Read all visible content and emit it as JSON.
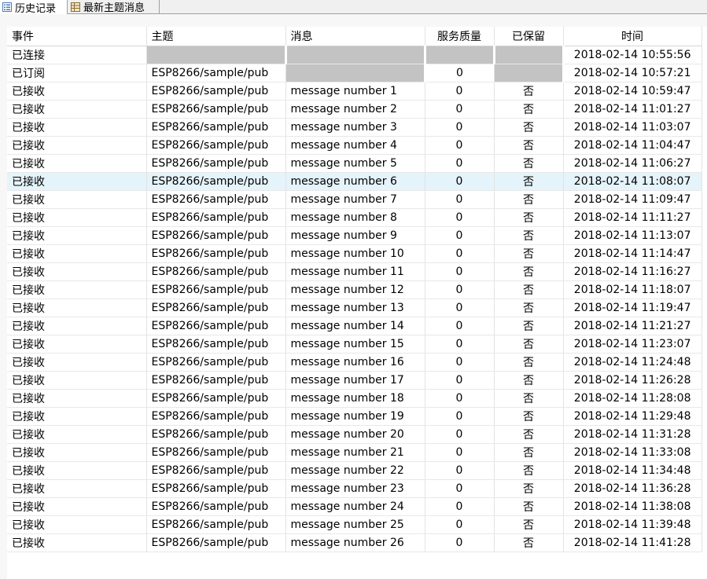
{
  "tabs": [
    {
      "label": "历史记录",
      "icon": "list-icon",
      "active": true
    },
    {
      "label": "最新主题消息",
      "icon": "table-icon",
      "active": false
    }
  ],
  "table": {
    "columns": [
      "事件",
      "主题",
      "消息",
      "服务质量",
      "已保留",
      "时间"
    ],
    "selected_row_index": 7,
    "rows": [
      {
        "event": "已连接",
        "topic": null,
        "message": null,
        "qos": null,
        "retained": null,
        "time": "2018-02-14 10:55:56"
      },
      {
        "event": "已订阅",
        "topic": "ESP8266/sample/pub",
        "message": null,
        "qos": "0",
        "retained": null,
        "time": "2018-02-14 10:57:21"
      },
      {
        "event": "已接收",
        "topic": "ESP8266/sample/pub",
        "message": "message number 1",
        "qos": "0",
        "retained": "否",
        "time": "2018-02-14 10:59:47"
      },
      {
        "event": "已接收",
        "topic": "ESP8266/sample/pub",
        "message": "message number 2",
        "qos": "0",
        "retained": "否",
        "time": "2018-02-14 11:01:27"
      },
      {
        "event": "已接收",
        "topic": "ESP8266/sample/pub",
        "message": "message number 3",
        "qos": "0",
        "retained": "否",
        "time": "2018-02-14 11:03:07"
      },
      {
        "event": "已接收",
        "topic": "ESP8266/sample/pub",
        "message": "message number 4",
        "qos": "0",
        "retained": "否",
        "time": "2018-02-14 11:04:47"
      },
      {
        "event": "已接收",
        "topic": "ESP8266/sample/pub",
        "message": "message number 5",
        "qos": "0",
        "retained": "否",
        "time": "2018-02-14 11:06:27"
      },
      {
        "event": "已接收",
        "topic": "ESP8266/sample/pub",
        "message": "message number 6",
        "qos": "0",
        "retained": "否",
        "time": "2018-02-14 11:08:07"
      },
      {
        "event": "已接收",
        "topic": "ESP8266/sample/pub",
        "message": "message number 7",
        "qos": "0",
        "retained": "否",
        "time": "2018-02-14 11:09:47"
      },
      {
        "event": "已接收",
        "topic": "ESP8266/sample/pub",
        "message": "message number 8",
        "qos": "0",
        "retained": "否",
        "time": "2018-02-14 11:11:27"
      },
      {
        "event": "已接收",
        "topic": "ESP8266/sample/pub",
        "message": "message number 9",
        "qos": "0",
        "retained": "否",
        "time": "2018-02-14 11:13:07"
      },
      {
        "event": "已接收",
        "topic": "ESP8266/sample/pub",
        "message": "message number 10",
        "qos": "0",
        "retained": "否",
        "time": "2018-02-14 11:14:47"
      },
      {
        "event": "已接收",
        "topic": "ESP8266/sample/pub",
        "message": "message number 11",
        "qos": "0",
        "retained": "否",
        "time": "2018-02-14 11:16:27"
      },
      {
        "event": "已接收",
        "topic": "ESP8266/sample/pub",
        "message": "message number 12",
        "qos": "0",
        "retained": "否",
        "time": "2018-02-14 11:18:07"
      },
      {
        "event": "已接收",
        "topic": "ESP8266/sample/pub",
        "message": "message number 13",
        "qos": "0",
        "retained": "否",
        "time": "2018-02-14 11:19:47"
      },
      {
        "event": "已接收",
        "topic": "ESP8266/sample/pub",
        "message": "message number 14",
        "qos": "0",
        "retained": "否",
        "time": "2018-02-14 11:21:27"
      },
      {
        "event": "已接收",
        "topic": "ESP8266/sample/pub",
        "message": "message number 15",
        "qos": "0",
        "retained": "否",
        "time": "2018-02-14 11:23:07"
      },
      {
        "event": "已接收",
        "topic": "ESP8266/sample/pub",
        "message": "message number 16",
        "qos": "0",
        "retained": "否",
        "time": "2018-02-14 11:24:48"
      },
      {
        "event": "已接收",
        "topic": "ESP8266/sample/pub",
        "message": "message number 17",
        "qos": "0",
        "retained": "否",
        "time": "2018-02-14 11:26:28"
      },
      {
        "event": "已接收",
        "topic": "ESP8266/sample/pub",
        "message": "message number 18",
        "qos": "0",
        "retained": "否",
        "time": "2018-02-14 11:28:08"
      },
      {
        "event": "已接收",
        "topic": "ESP8266/sample/pub",
        "message": "message number 19",
        "qos": "0",
        "retained": "否",
        "time": "2018-02-14 11:29:48"
      },
      {
        "event": "已接收",
        "topic": "ESP8266/sample/pub",
        "message": "message number 20",
        "qos": "0",
        "retained": "否",
        "time": "2018-02-14 11:31:28"
      },
      {
        "event": "已接收",
        "topic": "ESP8266/sample/pub",
        "message": "message number 21",
        "qos": "0",
        "retained": "否",
        "time": "2018-02-14 11:33:08"
      },
      {
        "event": "已接收",
        "topic": "ESP8266/sample/pub",
        "message": "message number 22",
        "qos": "0",
        "retained": "否",
        "time": "2018-02-14 11:34:48"
      },
      {
        "event": "已接收",
        "topic": "ESP8266/sample/pub",
        "message": "message number 23",
        "qos": "0",
        "retained": "否",
        "time": "2018-02-14 11:36:28"
      },
      {
        "event": "已接收",
        "topic": "ESP8266/sample/pub",
        "message": "message number 24",
        "qos": "0",
        "retained": "否",
        "time": "2018-02-14 11:38:08"
      },
      {
        "event": "已接收",
        "topic": "ESP8266/sample/pub",
        "message": "message number 25",
        "qos": "0",
        "retained": "否",
        "time": "2018-02-14 11:39:48"
      },
      {
        "event": "已接收",
        "topic": "ESP8266/sample/pub",
        "message": "message number 26",
        "qos": "0",
        "retained": "否",
        "time": "2018-02-14 11:41:28"
      }
    ]
  }
}
